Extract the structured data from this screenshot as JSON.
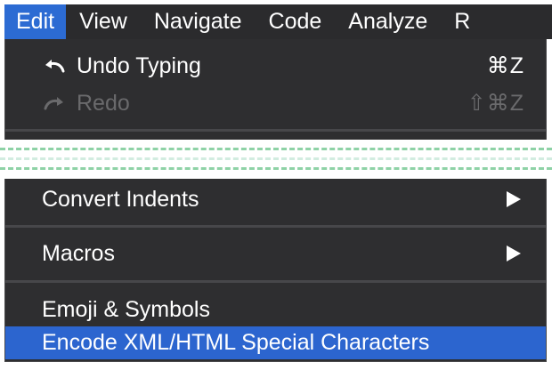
{
  "menubar": {
    "items": [
      {
        "label": "Edit",
        "active": true
      },
      {
        "label": "View",
        "active": false
      },
      {
        "label": "Navigate",
        "active": false
      },
      {
        "label": "Code",
        "active": false
      },
      {
        "label": "Analyze",
        "active": false
      },
      {
        "label": "R",
        "active": false
      }
    ]
  },
  "edit_menu": {
    "undo": {
      "label": "Undo Typing",
      "shortcut": "⌘Z",
      "icon": "undo-icon",
      "enabled": true
    },
    "redo": {
      "label": "Redo",
      "shortcut": "⇧⌘Z",
      "icon": "redo-icon",
      "enabled": false
    },
    "convert_indents": {
      "label": "Convert Indents",
      "has_submenu": true
    },
    "macros": {
      "label": "Macros",
      "has_submenu": true
    },
    "emoji_symbols": {
      "label": "Emoji & Symbols"
    },
    "encode_xml": {
      "label": "Encode XML/HTML Special Characters",
      "highlighted": true
    }
  },
  "colors": {
    "menu_background": "#2e2e30",
    "menubar_background": "#2b2b2d",
    "selection_blue": "#2c65cf",
    "disabled_text": "#6a6a6c",
    "tear_marker_green": "#8ed2a6"
  }
}
